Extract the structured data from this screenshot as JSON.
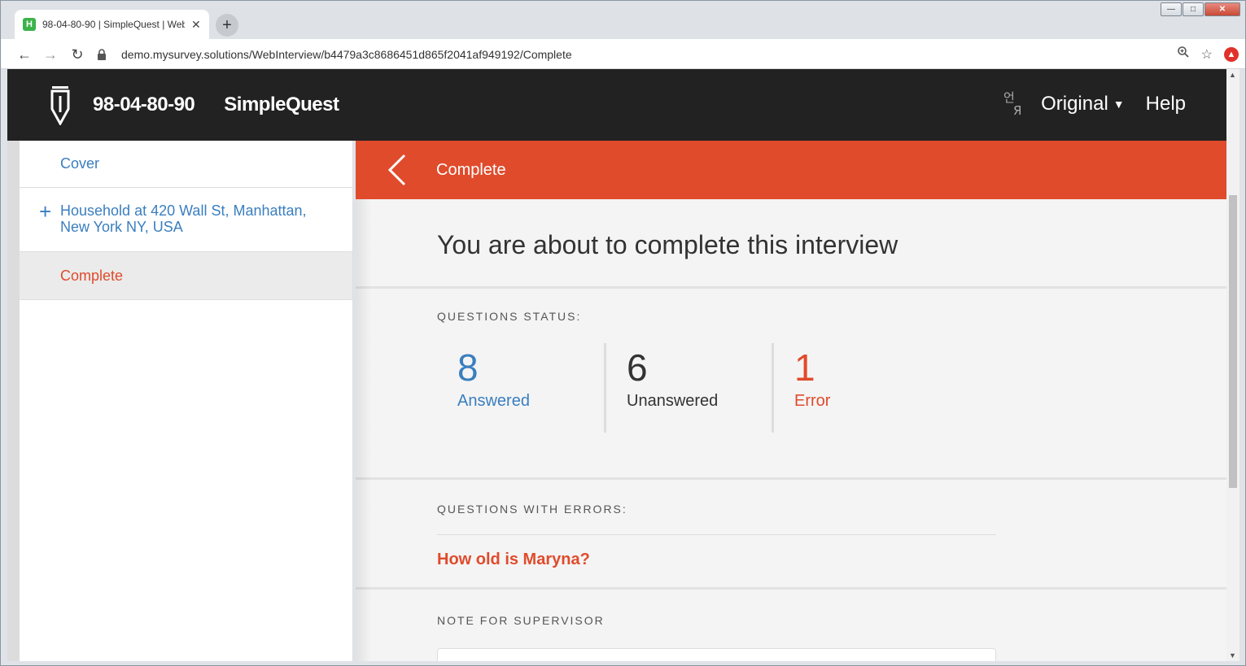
{
  "browser": {
    "tab_title": "98-04-80-90 | SimpleQuest | WebI",
    "tab_close": "✕",
    "new_tab": "+",
    "url": "demo.mysurvey.solutions/WebInterview/b4479a3c8686451d865f2041af949192/Complete",
    "favicon_letter": "H"
  },
  "header": {
    "interview_id": "98-04-80-90",
    "questionnaire": "SimpleQuest",
    "language": "Original",
    "help": "Help"
  },
  "sidebar": {
    "items": [
      {
        "label": "Cover"
      },
      {
        "label": "Household at 420 Wall St, Manhattan, New York NY, USA"
      },
      {
        "label": "Complete"
      }
    ]
  },
  "main": {
    "banner_title": "Complete",
    "headline": "You are about to complete this interview",
    "questions_status_label": "QUESTIONS STATUS:",
    "stats": {
      "answered": {
        "count": "8",
        "label": "Answered"
      },
      "unanswered": {
        "count": "6",
        "label": "Unanswered"
      },
      "error": {
        "count": "1",
        "label": "Error"
      }
    },
    "errors_label": "QUESTIONS WITH ERRORS:",
    "error_questions": [
      "How old is Maryna?"
    ],
    "note_label": "NOTE FOR SUPERVISOR"
  },
  "colors": {
    "accent": "#e04b2c",
    "link": "#3a7ebf",
    "header_bg": "#222222"
  }
}
